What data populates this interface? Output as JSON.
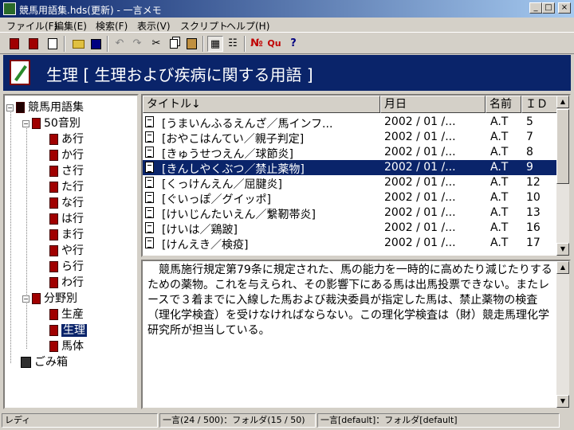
{
  "window": {
    "title": "競馬用語集.hds(更新) - 一言メモ",
    "controls": {
      "minimize": "_",
      "maximize": "□",
      "close": "×"
    }
  },
  "menu": [
    "ファイル(F)",
    "編集(E)",
    "検索(F)",
    "表示(V)",
    "スクリプト",
    "ヘルプ(H)"
  ],
  "toolbar": {
    "tools": [
      "new-book-icon",
      "edit-book-icon",
      "edit-note-icon",
      "open-folder-icon",
      "save-icon",
      "undo-icon",
      "redo-icon",
      "cut-icon",
      "copy-icon",
      "paste-icon",
      "view-grid-icon",
      "view-list-icon",
      "number-icon",
      "query-icon",
      "help-icon"
    ],
    "labels": {
      "number": "№",
      "query": "Qu",
      "help": "?"
    }
  },
  "banner": {
    "text": "生理 [ 生理および疾病に関する用語 ]"
  },
  "tree": {
    "root": "競馬用語集",
    "group1": "50音別",
    "group1_items": [
      "あ行",
      "か行",
      "さ行",
      "た行",
      "な行",
      "は行",
      "ま行",
      "や行",
      "ら行",
      "わ行"
    ],
    "group2": "分野別",
    "group2_items": [
      "生産",
      "生理",
      "馬体"
    ],
    "trash": "ごみ箱",
    "toggle_open": "−"
  },
  "list": {
    "columns": [
      "タイトル↓",
      "月日",
      "名前",
      "ＩＤ"
    ],
    "rows": [
      {
        "title": "[うまいんふるえんざ／馬インフ...",
        "date": "2002 / 01 /...",
        "name": "A.T",
        "id": "5"
      },
      {
        "title": "[おやこはんてい／親子判定]",
        "date": "2002 / 01 /...",
        "name": "A.T",
        "id": "7"
      },
      {
        "title": "[きゅうせつえん／球節炎]",
        "date": "2002 / 01 /...",
        "name": "A.T",
        "id": "8"
      },
      {
        "title": "[きんしやくぶつ／禁止薬物]",
        "date": "2002 / 01 /...",
        "name": "A.T",
        "id": "9"
      },
      {
        "title": "[くっけんえん／屈腱炎]",
        "date": "2002 / 01 /...",
        "name": "A.T",
        "id": "12"
      },
      {
        "title": "[ぐいっぽ／グイッポ]",
        "date": "2002 / 01 /...",
        "name": "A.T",
        "id": "10"
      },
      {
        "title": "[けいじんたいえん／繋靭帯炎]",
        "date": "2002 / 01 /...",
        "name": "A.T",
        "id": "13"
      },
      {
        "title": "[けいは／鶏跛]",
        "date": "2002 / 01 /...",
        "name": "A.T",
        "id": "16"
      },
      {
        "title": "[けんえき／検疫]",
        "date": "2002 / 01 /...",
        "name": "A.T",
        "id": "17"
      }
    ],
    "selected_index": 3,
    "scroll": {
      "up": "▲",
      "down": "▼"
    }
  },
  "content": {
    "text": "競馬施行規定第79条に規定された、馬の能力を一時的に高めたり減じたりするための薬物。これを与えられ、その影響下にある馬は出馬投票できない。またレースで３着までに入線した馬および裁決委員が指定した馬は、禁止薬物の検査（理化学検査）を受けなければならない。この理化学検査は（財）競走馬理化学研究所が担当している。",
    "scroll": {
      "up": "▲",
      "down": "▼"
    }
  },
  "status": {
    "ready": "レディ",
    "memo_count": "一言(24 / 500)：フォルダ(15 / 50)",
    "default": "一言[default]：フォルダ[default]"
  }
}
